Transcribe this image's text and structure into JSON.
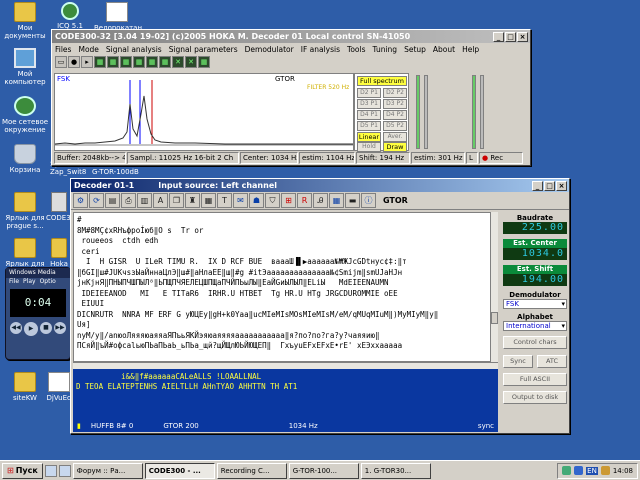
{
  "desktop": {
    "icons": [
      {
        "label": "Мои документы",
        "icon": "folder-icon"
      },
      {
        "label": "ICQ 5.1",
        "icon": "icq-icon"
      },
      {
        "label": "Велорокатан",
        "icon": "document-icon"
      },
      {
        "label": "Мой компьютер",
        "icon": "computer-icon"
      },
      {
        "label": "Мое сетевое окружение",
        "icon": "network-icon"
      },
      {
        "label": "Корзина",
        "icon": "recycle-bin-icon"
      },
      {
        "label": "Ярлык для Zap_Swit8",
        "icon": "shortcut-icon"
      },
      {
        "label": "Ярлык для prague s...",
        "icon": "folder-icon"
      },
      {
        "label": "CODE30",
        "icon": "app-icon"
      },
      {
        "label": "Ярлык для",
        "icon": "folder-icon"
      },
      {
        "label": "Hoka",
        "icon": "folder-icon"
      },
      {
        "label": "siteKW",
        "icon": "folder-icon"
      },
      {
        "label": "DjVuEd",
        "icon": "document-icon"
      }
    ],
    "floating_caption": "G-TOR-100dB"
  },
  "main_window": {
    "title": "CODE300-32 [3.04 19-02] (c)2005 HOKA M.   Decoder 01   Local control   SN-41050",
    "menu": [
      "Files",
      "Mode",
      "Signal analysis",
      "Signal parameters",
      "Demodulator",
      "IF analysis",
      "Tools",
      "Tuning",
      "Setup",
      "About",
      "Help"
    ],
    "spectrum": {
      "mode_label": "FSK",
      "center_label": "GTOR",
      "ok_label": "FILTER 520 Hz"
    },
    "side_buttons": [
      "Full spectrum",
      "D2 P1",
      "D2 P2",
      "D3 P1",
      "D3 P2",
      "D4 P1",
      "D4 P2",
      "D5 P1",
      "D5 P2",
      "Linear",
      "Aver.",
      "Hold",
      "Draw"
    ],
    "status": {
      "buffer": "Buffer: 2048kb--> 48 s",
      "sampl": "Sampl.: 11025 Hz 16-bit 2 Ch",
      "center": "Center: 1034 Hz",
      "estim": "estim: 1104 Hz",
      "shift": "Shift: 194 Hz",
      "estim2": "estim: 301 Hz",
      "l": "L",
      "rec": "Rec"
    }
  },
  "decoder_window": {
    "title": "Decoder 01-1",
    "source": "Input source: Left channel",
    "mode": "GTOR",
    "text_lines": [
      "#",
      "8M#8MÇ¢хRНъфpoÍюб‖O s  Tr or",
      " roueeos  ctdh edh",
      " ceri",
      "  I  H GISR  U ILeR TIMU R.  IX D RCF BUE  ваааШ▐▌▶аааааа№₩ЖJcGDtнуc¢‡:‖т",
      "‖бGI‖ш#JUКчsзЫаЙннаЦлЭ‖ш#‖аНлаЕЕ‖ш‖#g #itЭаааааааааааааа№¢Smijm‖smUJаHJн",
      "jнКjнЯ‖ПНЫПЧШПЫЛ⁸‖ЬПЩПЧЯЕЛЕЦШПЩаПЧЙПЬыЛЫ‖ЕаЙGиЫЛЫЛ‖ЕLiЫ   MdEIEENAUMN",
      " IDEIEEANOD   MI   E TITаR6  IRHR.U HTBET  Tg HR.U HTg JRGCDUROMMIE oEE",
      " EIUUI",
      "DICNRUTR  NNRA MF ERF G уЮЦEy‖gH+k0Yаа‖ucMIeMIsMOsMIeMIsM/eM/qMUqMIuM‖)MyMIyM‖у‖",
      "Uя]",
      "nуM/у‖/anюоЛяяяюаяяаЯПъьЯКЙэяюаяяяяааааааааааа‖я?по?по?га?у?чаяяию‖",
      "ПСяЙ‖ъЙ#офсаlьюПЬаПЬаЬ_ьПЬа_щй?щЙЩлЮЬЙЮЩЕП‖  ГхъуuЕFхЕFхЕ•rЕ' хЕЭххааааа"
    ],
    "blue_lines": [
      "          i&&‖f#ааааааCALeALLS !LOAALLNAL",
      "D TEOA ELATEPTENHS AIELTLLH AHnTYAO AHHTTN TH AT1"
    ],
    "status": {
      "left": "HUFFB 8# 0",
      "mode": "GTOR 200",
      "freq": "1034 Hz",
      "sync": "sync"
    },
    "right_panel": {
      "baudrate_label": "Baudrate",
      "baudrate_value": "225.00",
      "center_label": "Est. Center",
      "center_value": "1034.0",
      "shift_label": "Est. Shift",
      "shift_value": "194.00",
      "demod_label": "Demodulator",
      "demod_value": "FSK",
      "alphabet_label": "Alphabet",
      "alphabet_value": "International",
      "buttons": {
        "control_chars": "Control chars",
        "sync": "Sync",
        "atc": "ATC",
        "full_ascii": "Full ASCII",
        "output_to_disk": "Output to disk"
      }
    }
  },
  "media_player": {
    "title": "Windows Media",
    "menu": [
      "File",
      "Play",
      "Optio"
    ],
    "time": "0:04"
  },
  "taskbar": {
    "start_label": "Пуск",
    "tasks": [
      "Форум :: Ра...",
      "CODE300 - ...",
      "Recording C...",
      "G-TOR-100...",
      "1. G-TOR30..."
    ],
    "lang": "EN",
    "clock": "14:08"
  },
  "colors": {
    "desktop": "#2e5da8",
    "titlebar_active": "#0a246a",
    "decoder_blue": "#0a37a0",
    "digit_cyan": "#2cc9e0",
    "panel_green": "#0a8a3a"
  }
}
